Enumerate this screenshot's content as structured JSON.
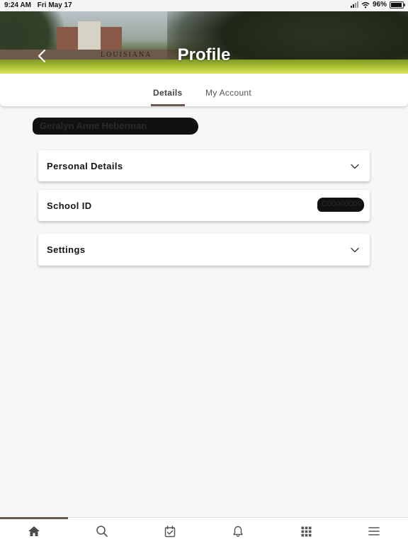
{
  "status_bar": {
    "time": "9:24 AM",
    "date": "Fri May 17",
    "battery": "96%",
    "battery_level": 0.96
  },
  "header": {
    "title": "Profile",
    "banner_sign_text": "LOUISIANA",
    "back_icon": "chevron-left-icon"
  },
  "tabs": [
    {
      "label": "Details",
      "active": true
    },
    {
      "label": "My Account",
      "active": false
    }
  ],
  "profile": {
    "name_redacted": "Geralyn Anne Heberman"
  },
  "cards": {
    "personal_details": {
      "label": "Personal Details",
      "icon": "chevron-down-icon"
    },
    "school_id": {
      "label": "School ID",
      "value_redacted": "C00000000"
    },
    "settings": {
      "label": "Settings",
      "icon": "chevron-down-icon"
    }
  },
  "bottom_nav": {
    "items": [
      "home-icon",
      "search-icon",
      "calendar-check-icon",
      "bell-icon",
      "apps-grid-icon",
      "menu-icon"
    ],
    "active_index": 0
  },
  "colors": {
    "accent": "#6b5a52",
    "background": "#f7f7f7",
    "card": "#ffffff",
    "title_text": "#ffffff"
  }
}
